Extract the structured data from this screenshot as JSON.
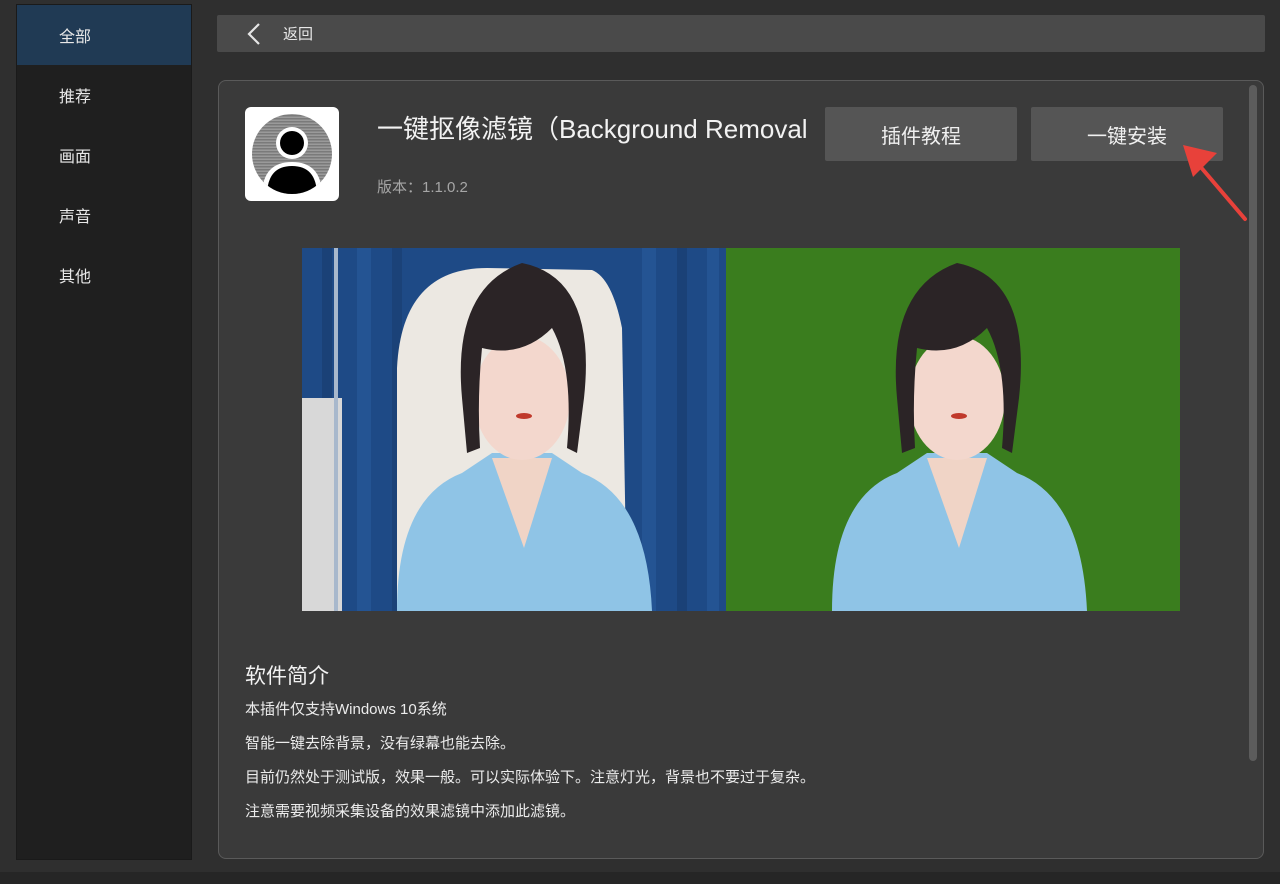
{
  "sidebar": {
    "items": [
      {
        "label": "全部",
        "active": true
      },
      {
        "label": "推荐",
        "active": false
      },
      {
        "label": "画面",
        "active": false
      },
      {
        "label": "声音",
        "active": false
      },
      {
        "label": "其他",
        "active": false
      }
    ]
  },
  "topbar": {
    "back_label": "返回"
  },
  "plugin": {
    "title": "一键抠像滤镜（Background Removal",
    "version": "版本：1.1.0.2",
    "icon": "user-avatar-icon"
  },
  "buttons": {
    "tutorial_label": "插件教程",
    "install_label": "一键安装"
  },
  "annotation": {
    "arrow_color": "#e8413a",
    "target": "install-button"
  },
  "preview": {
    "left_background": "blue-curtain",
    "right_background_color": "#3a7d1e"
  },
  "intro": {
    "title": "软件简介",
    "lines": [
      "本插件仅支持Windows 10系统",
      "智能一键去除背景，没有绿幕也能去除。",
      "目前仍然处于测试版，效果一般。可以实际体验下。注意灯光，背景也不要过于复杂。",
      "注意需要视频采集设备的效果滤镜中添加此滤镜。"
    ]
  },
  "colors": {
    "sidebar_active": "#203a54",
    "panel_bg": "#3a3a3a",
    "button_bg": "#555555"
  }
}
